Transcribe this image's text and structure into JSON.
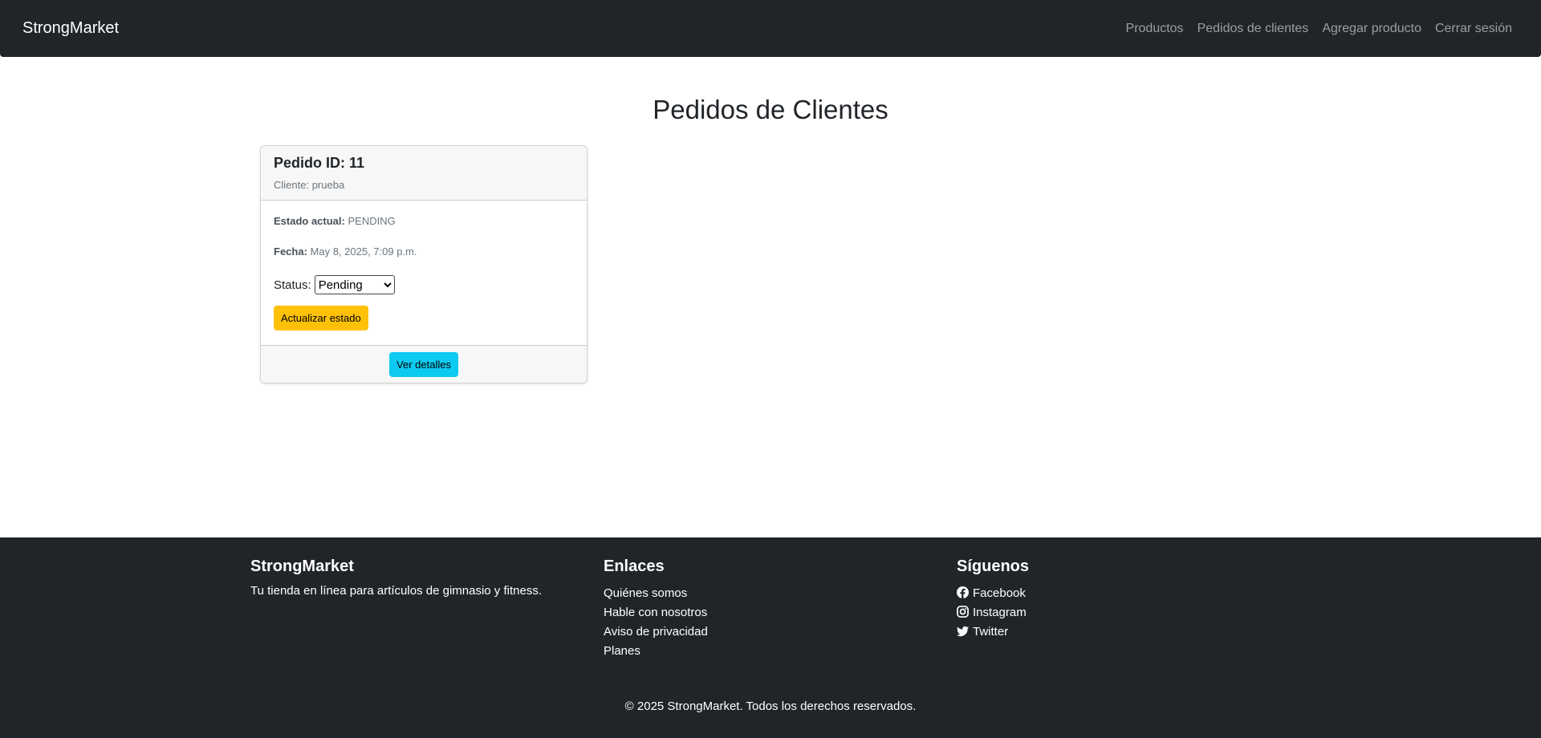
{
  "navbar": {
    "brand": "StrongMarket",
    "links": [
      "Productos",
      "Pedidos de clientes",
      "Agregar producto",
      "Cerrar sesión"
    ]
  },
  "main": {
    "title": "Pedidos de Clientes",
    "order": {
      "title": "Pedido ID: 11",
      "client": "Cliente: prueba",
      "status_label": "Estado actual:",
      "status_value": "PENDING",
      "date_label": "Fecha:",
      "date_value": "May 8, 2025, 7:09 p.m.",
      "select_label": "Status:",
      "select_value": "Pending",
      "update_button": "Actualizar estado",
      "details_button": "Ver detalles"
    }
  },
  "footer": {
    "brand_title": "StrongMarket",
    "brand_text": "Tu tienda en línea para artículos de gimnasio y fitness.",
    "links_title": "Enlaces",
    "links": [
      "Quiénes somos",
      "Hable con nosotros",
      "Aviso de privacidad",
      "Planes"
    ],
    "social_title": "Síguenos",
    "social": [
      {
        "icon": "facebook-icon",
        "label": "Facebook"
      },
      {
        "icon": "instagram-icon",
        "label": "Instagram"
      },
      {
        "icon": "twitter-icon",
        "label": "Twitter"
      }
    ],
    "copyright": "© 2025 StrongMarket. Todos los derechos reservados."
  },
  "colors": {
    "dark": "#212529",
    "warning": "#ffc107",
    "info": "#0dcaf0"
  }
}
